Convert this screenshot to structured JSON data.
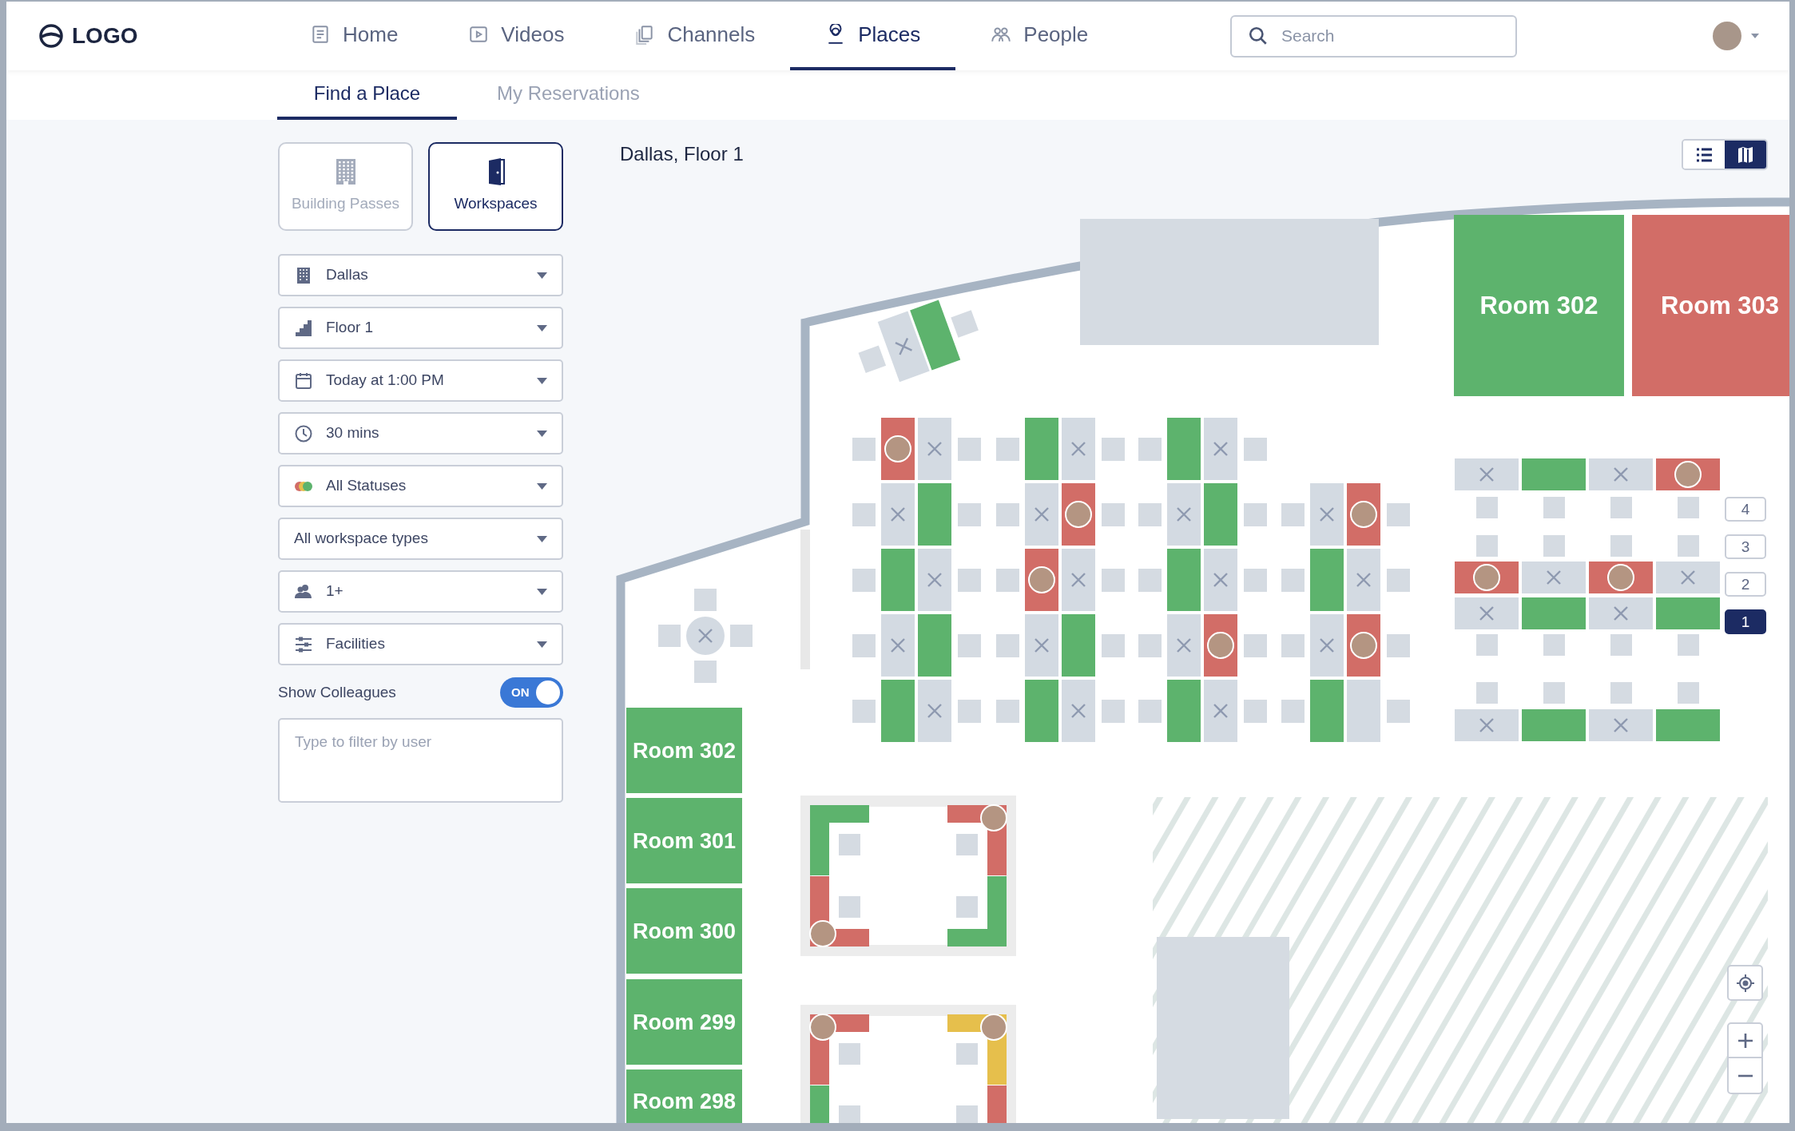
{
  "header": {
    "logo": "LOGO",
    "nav": [
      {
        "label": "Home",
        "kind": "document",
        "selected": false
      },
      {
        "label": "Videos",
        "kind": "video",
        "selected": false
      },
      {
        "label": "Channels",
        "kind": "copies",
        "selected": false
      },
      {
        "label": "Places",
        "kind": "pin",
        "selected": true
      },
      {
        "label": "People",
        "kind": "people",
        "selected": false
      }
    ],
    "search": {
      "placeholder": "Search"
    }
  },
  "subtabs": [
    {
      "label": "Find a Place",
      "selected": true
    },
    {
      "label": "My Reservations",
      "selected": false
    }
  ],
  "sidebar": {
    "types": [
      {
        "label": "Building Passes",
        "kind": "building",
        "selected": false
      },
      {
        "label": "Workspaces",
        "kind": "door",
        "selected": true
      }
    ],
    "filters": [
      {
        "kind": "building",
        "value": "Dallas"
      },
      {
        "kind": "floor",
        "value": "Floor 1"
      },
      {
        "kind": "date",
        "value": "Today at 1:00 PM"
      },
      {
        "kind": "duration",
        "value": "30 mins"
      },
      {
        "kind": "status",
        "value": "All Statuses"
      },
      {
        "kind": "plain",
        "value": "All workspace types"
      },
      {
        "kind": "people",
        "value": "1+"
      },
      {
        "kind": "facilities",
        "value": "Facilities"
      }
    ],
    "colleagues": {
      "label": "Show Colleagues",
      "on": true,
      "state_text": "ON"
    },
    "user_filter": {
      "placeholder": "Type to filter by user"
    }
  },
  "map": {
    "title": "Dallas, Floor 1",
    "views": [
      {
        "kind": "list",
        "selected": false
      },
      {
        "kind": "map",
        "selected": true
      }
    ],
    "top_rooms": [
      {
        "label": "Room 302",
        "kind": "available"
      },
      {
        "label": "Room 303",
        "kind": "booked"
      }
    ],
    "side_rooms": [
      {
        "label": "Room 302",
        "kind": "available"
      },
      {
        "label": "Room 301",
        "kind": "available"
      },
      {
        "label": "Room 300",
        "kind": "available"
      },
      {
        "label": "Room 299",
        "kind": "available"
      },
      {
        "label": "Room 298",
        "kind": "available"
      }
    ],
    "angled_desks": [
      {
        "kind": "unavailable",
        "colleague": false
      },
      {
        "kind": "available",
        "colleague": false
      }
    ],
    "round_table": {
      "kind": "unavailable"
    },
    "clusters": [
      {
        "rows": [
          [
            {
              "kind": "booked",
              "colleague": true
            },
            {
              "kind": "unavailable",
              "colleague": false
            }
          ],
          [
            {
              "kind": "unavailable",
              "colleague": false
            },
            {
              "kind": "available",
              "colleague": false
            }
          ],
          [
            {
              "kind": "available",
              "colleague": false
            },
            {
              "kind": "unavailable",
              "colleague": false
            }
          ],
          [
            {
              "kind": "unavailable",
              "colleague": false
            },
            {
              "kind": "available",
              "colleague": false
            }
          ],
          [
            {
              "kind": "available",
              "colleague": false
            },
            {
              "kind": "unavailable",
              "colleague": false
            }
          ]
        ]
      },
      {
        "rows": [
          [
            {
              "kind": "available",
              "colleague": false
            },
            {
              "kind": "unavailable",
              "colleague": false
            }
          ],
          [
            {
              "kind": "unavailable",
              "colleague": false
            },
            {
              "kind": "booked",
              "colleague": true
            }
          ],
          [
            {
              "kind": "booked",
              "colleague": true
            },
            {
              "kind": "unavailable",
              "colleague": false
            }
          ],
          [
            {
              "kind": "unavailable",
              "colleague": false
            },
            {
              "kind": "available",
              "colleague": false
            }
          ],
          [
            {
              "kind": "available",
              "colleague": false
            },
            {
              "kind": "unavailable",
              "colleague": false
            }
          ]
        ]
      },
      {
        "rows": [
          [
            {
              "kind": "available",
              "colleague": false
            },
            {
              "kind": "unavailable",
              "colleague": false
            }
          ],
          [
            {
              "kind": "unavailable",
              "colleague": false
            },
            {
              "kind": "available",
              "colleague": false
            }
          ],
          [
            {
              "kind": "available",
              "colleague": false
            },
            {
              "kind": "unavailable",
              "colleague": false
            }
          ],
          [
            {
              "kind": "unavailable",
              "colleague": false
            },
            {
              "kind": "booked",
              "colleague": true
            }
          ],
          [
            {
              "kind": "available",
              "colleague": false
            },
            {
              "kind": "unavailable",
              "colleague": false
            }
          ]
        ]
      },
      {
        "rows": [
          [
            {
              "kind": "unavailable",
              "colleague": false
            },
            {
              "kind": "booked",
              "colleague": true
            }
          ],
          [
            {
              "kind": "available",
              "colleague": false
            },
            {
              "kind": "unavailable",
              "colleague": false
            }
          ],
          [
            {
              "kind": "unavailable",
              "colleague": false
            },
            {
              "kind": "booked",
              "colleague": true
            }
          ],
          [
            {
              "kind": "available",
              "colleague": false
            },
            {
              "kind": "empty",
              "colleague": false
            }
          ]
        ]
      }
    ],
    "block_rows": [
      [
        {
          "kind": "unavailable",
          "colleague": false
        },
        {
          "kind": "available",
          "colleague": false
        },
        {
          "kind": "unavailable",
          "colleague": false
        },
        {
          "kind": "booked",
          "colleague": true
        }
      ],
      [
        {
          "kind": "booked",
          "colleague": true
        },
        {
          "kind": "unavailable",
          "colleague": false
        },
        {
          "kind": "booked",
          "colleague": true
        },
        {
          "kind": "unavailable",
          "colleague": false
        }
      ],
      [
        {
          "kind": "unavailable",
          "colleague": false
        },
        {
          "kind": "available",
          "colleague": false
        },
        {
          "kind": "unavailable",
          "colleague": false
        },
        {
          "kind": "available",
          "colleague": false
        }
      ],
      [
        {
          "kind": "unavailable",
          "colleague": false
        },
        {
          "kind": "available",
          "colleague": false
        },
        {
          "kind": "unavailable",
          "colleague": false
        },
        {
          "kind": "available",
          "colleague": false
        }
      ]
    ],
    "pods": [
      {
        "desks": [
          {
            "kind": "available",
            "colleague": false
          },
          {
            "kind": "booked",
            "colleague": true
          },
          {
            "kind": "booked",
            "colleague": true
          },
          {
            "kind": "available",
            "colleague": false
          }
        ]
      },
      {
        "desks": [
          {
            "kind": "booked",
            "colleague": true
          },
          {
            "kind": "pending",
            "colleague": true
          },
          {
            "kind": "available"
          },
          {
            "kind": "booked"
          }
        ]
      }
    ],
    "floors": [
      {
        "label": "4",
        "selected": false
      },
      {
        "label": "3",
        "selected": false
      },
      {
        "label": "2",
        "selected": false
      },
      {
        "label": "1",
        "selected": true
      }
    ]
  }
}
